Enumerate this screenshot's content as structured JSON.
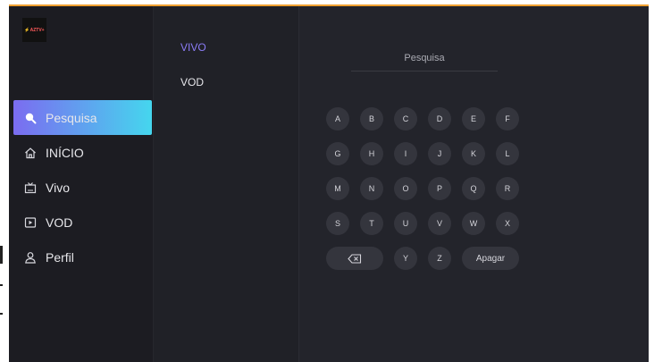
{
  "logo_text": "⚡AZTV+",
  "nav": [
    {
      "label": "Pesquisa",
      "icon": "search-icon",
      "active": true
    },
    {
      "label": "INÍCIO",
      "icon": "home-icon"
    },
    {
      "label": "Vivo",
      "icon": "tv-icon"
    },
    {
      "label": "VOD",
      "icon": "play-icon"
    },
    {
      "label": "Perfil",
      "icon": "user-icon"
    }
  ],
  "categories": [
    {
      "label": "VIVO",
      "selected": true
    },
    {
      "label": "VOD"
    }
  ],
  "search": {
    "placeholder": "Pesquisa"
  },
  "keyboard": {
    "rows": [
      [
        "A",
        "B",
        "C",
        "D",
        "E",
        "F"
      ],
      [
        "G",
        "H",
        "I",
        "J",
        "K",
        "L"
      ],
      [
        "M",
        "N",
        "O",
        "P",
        "Q",
        "R"
      ],
      [
        "S",
        "T",
        "U",
        "V",
        "W",
        "X"
      ]
    ],
    "last_row": [
      "Y",
      "Z"
    ],
    "delete_label": "Apagar"
  },
  "colors": {
    "accent_start": "#7b6cf0",
    "accent_end": "#45d6ee",
    "category_selected": "#8b7cf6",
    "top_line": "#f0a030"
  }
}
